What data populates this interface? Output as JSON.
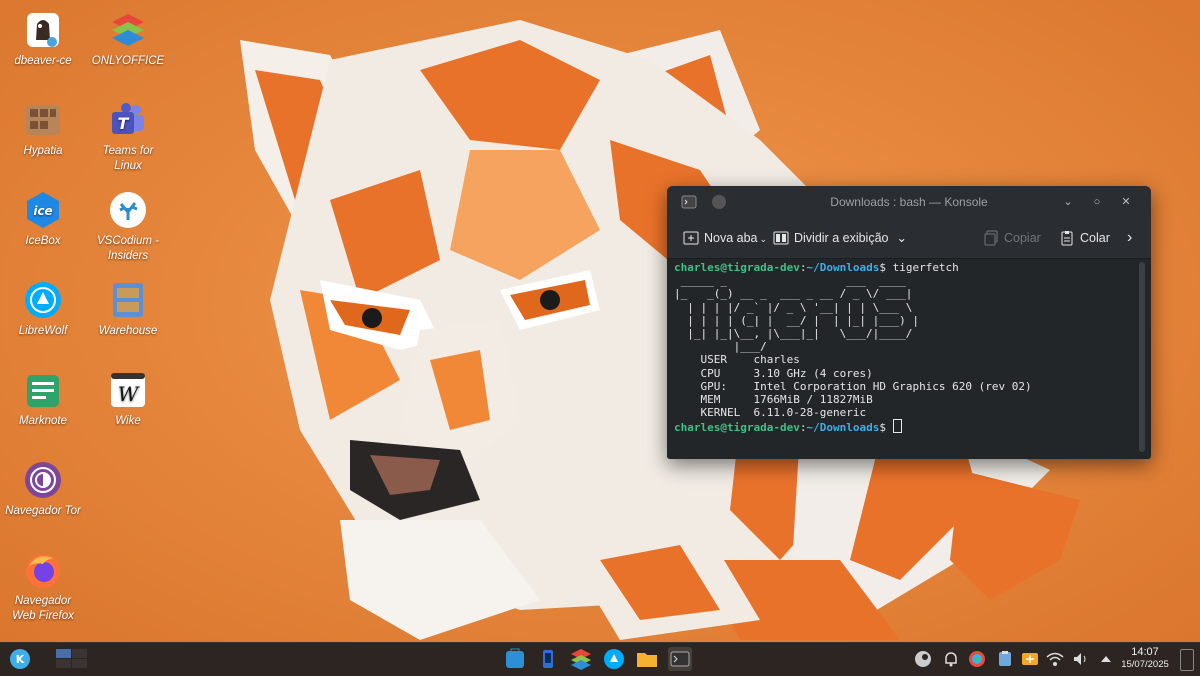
{
  "desktop": {
    "icons": [
      {
        "label": "dbeaver-ce",
        "icon": "dbeaver-icon"
      },
      {
        "label": "ONLYOFFICE",
        "icon": "onlyoffice-icon"
      },
      {
        "label": "Hypatia",
        "icon": "hypatia-icon"
      },
      {
        "label": "Teams for Linux",
        "icon": "teams-icon"
      },
      {
        "label": "IceBox",
        "icon": "icebox-icon"
      },
      {
        "label": "VSCodium - Insiders",
        "icon": "vscodium-icon"
      },
      {
        "label": "LibreWolf",
        "icon": "librewolf-icon"
      },
      {
        "label": "Warehouse",
        "icon": "warehouse-icon"
      },
      {
        "label": "Marknote",
        "icon": "marknote-icon"
      },
      {
        "label": "Wike",
        "icon": "wike-icon"
      },
      {
        "label": "Navegador Tor",
        "icon": "tor-icon"
      },
      {
        "label": "Navegador Web Firefox",
        "icon": "firefox-icon"
      }
    ]
  },
  "konsole": {
    "title": "Downloads : bash — Konsole",
    "toolbar": {
      "new_tab": "Nova aba",
      "split_view": "Dividir a exibição",
      "copy": "Copiar",
      "paste": "Colar"
    },
    "terminal": {
      "prompt_user": "charles@tigrada-dev",
      "prompt_sep": ":",
      "prompt_path": "~/Downloads",
      "prompt_end": "$ ",
      "command": "tigerfetch",
      "ascii_art": " _____ _                  ___  ____\n|_   _(_) __ _  ___ _ __ / _ \\/ ___|\n  | | | |/ _` |/ _ \\ '__| | | \\___ \\\n  | | | | (_| |  __/ |  | |_| |___) |\n  |_| |_|\\__, |\\___|_|   \\___/|____/\n         |___/",
      "info": [
        {
          "key": "USER  ",
          "value": "charles"
        },
        {
          "key": "CPU   ",
          "value": "3.10 GHz (4 cores)"
        },
        {
          "key": "GPU:  ",
          "value": "Intel Corporation HD Graphics 620 (rev 02)"
        },
        {
          "key": "MEM   ",
          "value": "1766MiB / 11827MiB"
        },
        {
          "key": "KERNEL",
          "value": "6.11.0-28-generic"
        }
      ]
    }
  },
  "taskbar": {
    "time": "14:07",
    "date": "15/07/2025",
    "pinned": [
      "kde-menu-icon",
      "pager",
      "store-icon",
      "phone-icon",
      "virtualbox-icon",
      "librewolf-icon",
      "files-icon",
      "konsole-icon"
    ],
    "tray": [
      "steam-icon",
      "bell-icon",
      "color-picker-icon",
      "clipboard-icon",
      "updates-icon",
      "wifi-icon",
      "volume-icon",
      "chevron-up-icon"
    ]
  },
  "colors": {
    "accent": "#3daee9",
    "prompt_user": "#3fc184",
    "wallpaper": "#e8883e"
  }
}
